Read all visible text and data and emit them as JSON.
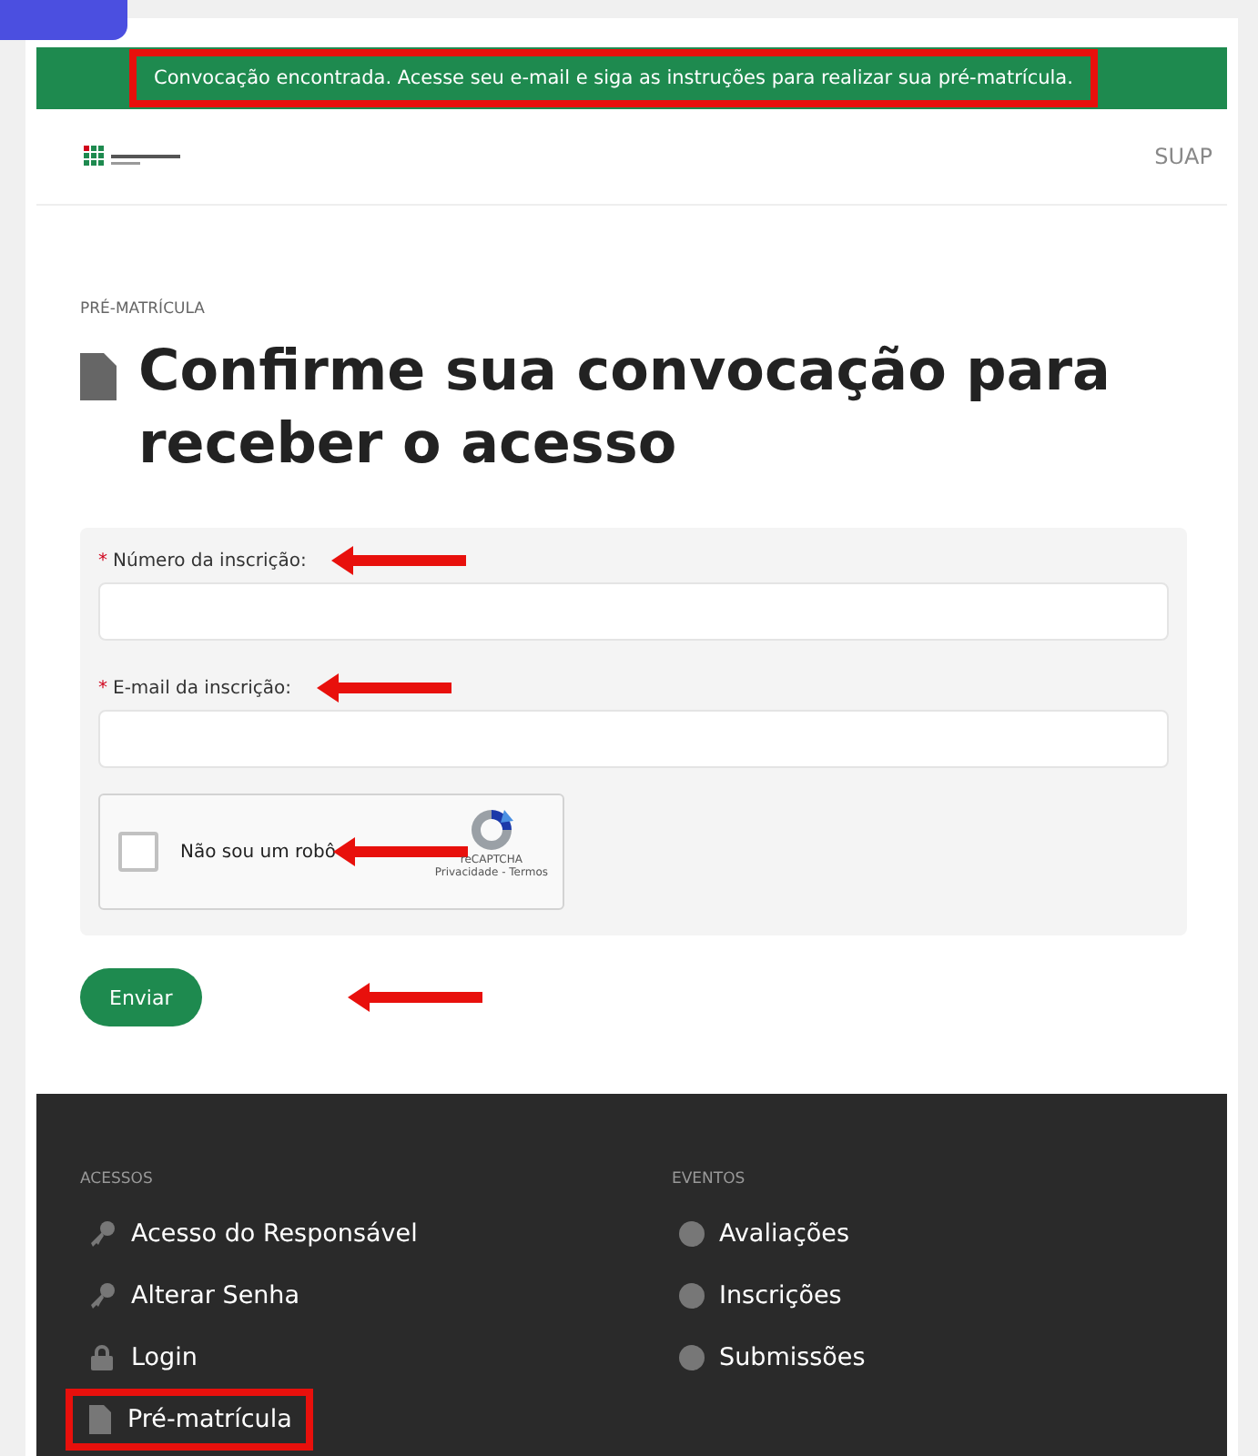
{
  "banner": {
    "text": "Convocação encontrada. Acesse seu e-mail e siga as instruções para realizar sua pré-matrícula.",
    "highlighted": true
  },
  "header": {
    "link": "SUAP"
  },
  "breadcrumb": "PRÉ-MATRÍCULA",
  "title": "Confirme sua convocação para receber o acesso",
  "form": {
    "fields": [
      {
        "label": "Número da inscrição:",
        "marker": "*",
        "annotated": true
      },
      {
        "label": "E-mail da inscrição:",
        "marker": "*",
        "annotated": true
      }
    ],
    "captcha": {
      "label": "Não sou um robô",
      "checked": false,
      "brand": "reCAPTCHA",
      "links": "Privacidade - Termos",
      "annotated": true
    },
    "submit": {
      "label": "Enviar",
      "annotated": true
    }
  },
  "footer": {
    "sections": [
      {
        "heading": "ACESSOS",
        "items": [
          {
            "label": "Acesso do Responsável",
            "kind": "key",
            "highlighted": false
          },
          {
            "label": "Alterar Senha",
            "kind": "key",
            "highlighted": false
          },
          {
            "label": "Login",
            "kind": "lock",
            "highlighted": false
          },
          {
            "label": "Pré-matrícula",
            "kind": "file",
            "highlighted": true
          }
        ]
      },
      {
        "heading": "EVENTOS",
        "items": [
          {
            "label": "Avaliações",
            "kind": "dot",
            "highlighted": false
          },
          {
            "label": "Inscrições",
            "kind": "dot",
            "highlighted": false
          },
          {
            "label": "Submissões",
            "kind": "dot",
            "highlighted": false
          }
        ]
      }
    ]
  }
}
